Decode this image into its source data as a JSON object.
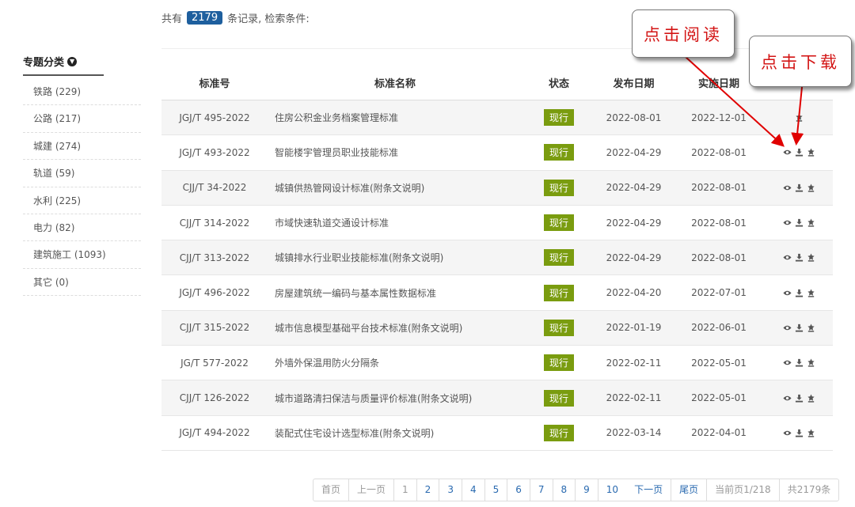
{
  "summary": {
    "prefix": "共有",
    "count": "2179",
    "suffix": "条记录, 检索条件:"
  },
  "sidebar": {
    "title": "专题分类",
    "items": [
      {
        "label": "铁路 (229)"
      },
      {
        "label": "公路 (217)"
      },
      {
        "label": "城建 (274)"
      },
      {
        "label": "轨道 (59)"
      },
      {
        "label": "水利 (225)"
      },
      {
        "label": "电力 (82)"
      },
      {
        "label": "建筑施工 (1093)"
      },
      {
        "label": "其它 (0)"
      }
    ]
  },
  "table": {
    "headers": {
      "code": "标准号",
      "name": "标准名称",
      "status": "状态",
      "publish": "发布日期",
      "implement": "实施日期"
    },
    "rows": [
      {
        "code": "JGJ/T 495-2022",
        "name": "住房公积金业务档案管理标准",
        "status": "现行",
        "publish": "2022-08-01",
        "implement": "2022-12-01"
      },
      {
        "code": "JGJ/T 493-2022",
        "name": "智能楼宇管理员职业技能标准",
        "status": "现行",
        "publish": "2022-04-29",
        "implement": "2022-08-01"
      },
      {
        "code": "CJJ/T 34-2022",
        "name": "城镇供热管网设计标准(附条文说明)",
        "status": "现行",
        "publish": "2022-04-29",
        "implement": "2022-08-01"
      },
      {
        "code": "CJJ/T 314-2022",
        "name": "市域快速轨道交通设计标准",
        "status": "现行",
        "publish": "2022-04-29",
        "implement": "2022-08-01"
      },
      {
        "code": "CJJ/T 313-2022",
        "name": "城镇排水行业职业技能标准(附条文说明)",
        "status": "现行",
        "publish": "2022-04-29",
        "implement": "2022-08-01"
      },
      {
        "code": "JGJ/T 496-2022",
        "name": "房屋建筑统一编码与基本属性数据标准",
        "status": "现行",
        "publish": "2022-04-20",
        "implement": "2022-07-01"
      },
      {
        "code": "CJJ/T 315-2022",
        "name": "城市信息模型基础平台技术标准(附条文说明)",
        "status": "现行",
        "publish": "2022-01-19",
        "implement": "2022-06-01"
      },
      {
        "code": "JG/T 577-2022",
        "name": "外墙外保温用防火分隔条",
        "status": "现行",
        "publish": "2022-02-11",
        "implement": "2022-05-01"
      },
      {
        "code": "CJJ/T 126-2022",
        "name": "城市道路清扫保洁与质量评价标准(附条文说明)",
        "status": "现行",
        "publish": "2022-02-11",
        "implement": "2022-05-01"
      },
      {
        "code": "JGJ/T 494-2022",
        "name": "装配式住宅设计选型标准(附条文说明)",
        "status": "现行",
        "publish": "2022-03-14",
        "implement": "2022-04-01"
      }
    ]
  },
  "pagination": {
    "first": "首页",
    "prev": "上一页",
    "pages": [
      "1",
      "2",
      "3",
      "4",
      "5",
      "6",
      "7",
      "8",
      "9",
      "10"
    ],
    "next": "下一页",
    "last": "尾页",
    "current": "当前页1/218",
    "total": "共2179条"
  },
  "callouts": {
    "read": "点击阅读",
    "download": "点击下载"
  },
  "icons": {
    "view": "eye-icon",
    "download": "download-icon",
    "favorite": "bookmark-icon"
  },
  "colors": {
    "status_badge": "#7a9c0f",
    "count_badge": "#1e5f9e",
    "callout_text": "#d31515",
    "arrow": "#e00000"
  }
}
